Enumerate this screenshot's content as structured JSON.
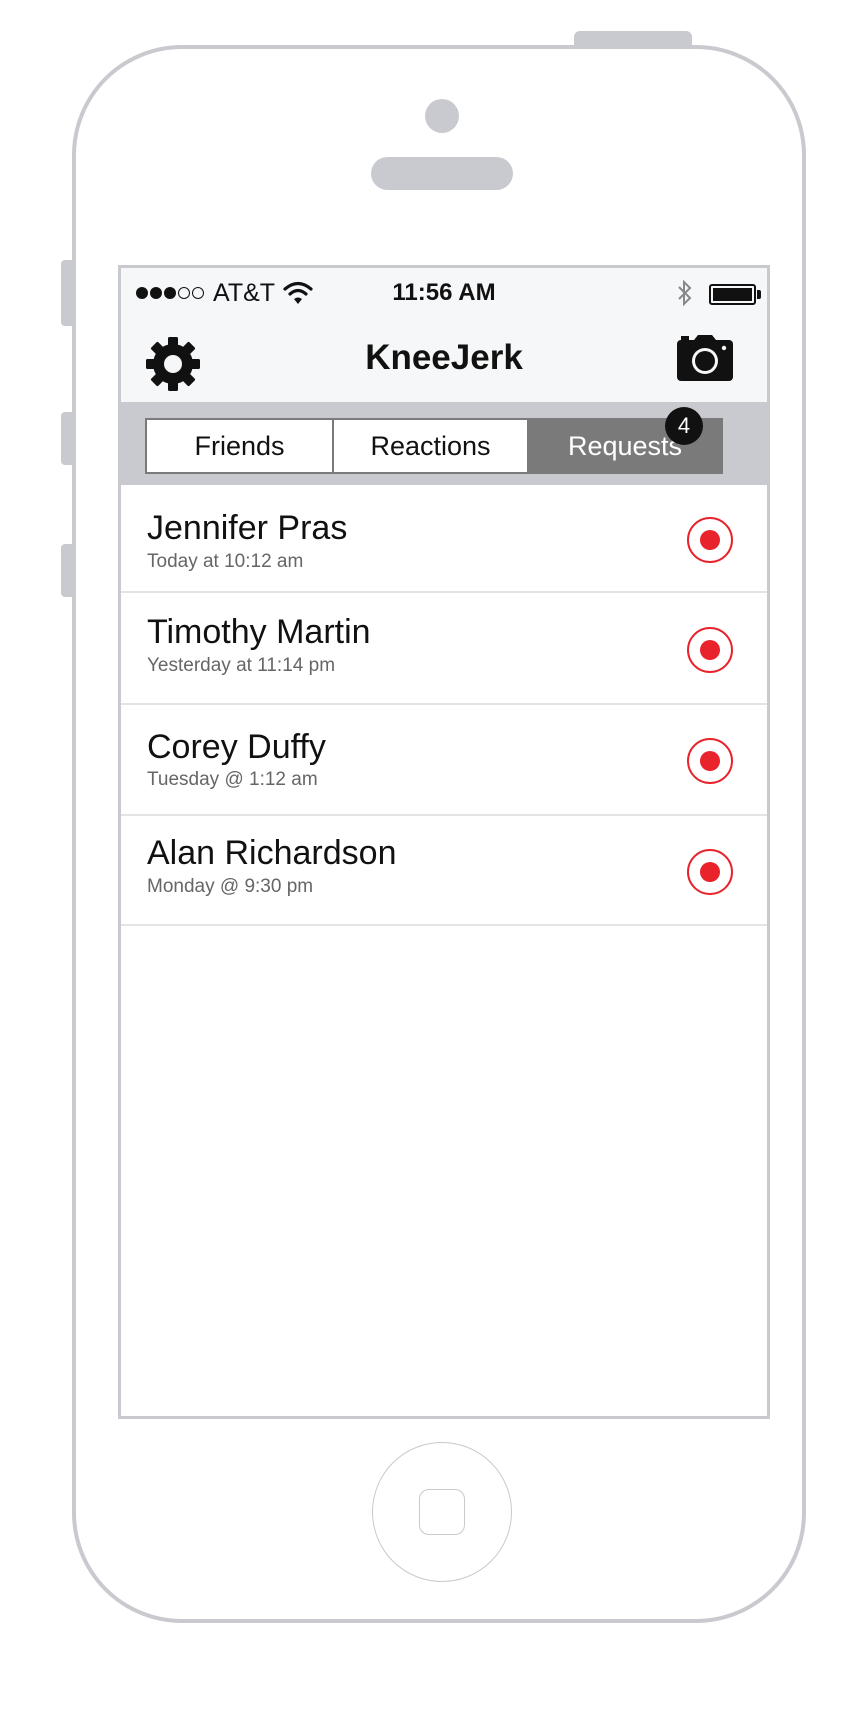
{
  "status_bar": {
    "carrier": "AT&T",
    "time": "11:56 AM",
    "signal_bars_filled": 3,
    "signal_bars_total": 5,
    "battery_level": 1.0
  },
  "nav": {
    "title": "KneeJerk",
    "left_icon": "gear-icon",
    "right_icon": "camera-icon"
  },
  "tabs": [
    {
      "label": "Friends",
      "active": false
    },
    {
      "label": "Reactions",
      "active": false
    },
    {
      "label": "Requests",
      "active": true,
      "badge": "4"
    }
  ],
  "requests": [
    {
      "name": "Jennifer Pras",
      "time": "Today at 10:12 am"
    },
    {
      "name": "Timothy Martin",
      "time": "Yesterday at 11:14 pm"
    },
    {
      "name": "Corey Duffy",
      "time": "Tuesday @ 1:12 am"
    },
    {
      "name": "Alan Richardson",
      "time": "Monday @ 9:30 pm"
    }
  ],
  "colors": {
    "accent_red": "#e8232b",
    "active_tab": "#7a7a7a",
    "frame": "#c9cacf"
  }
}
